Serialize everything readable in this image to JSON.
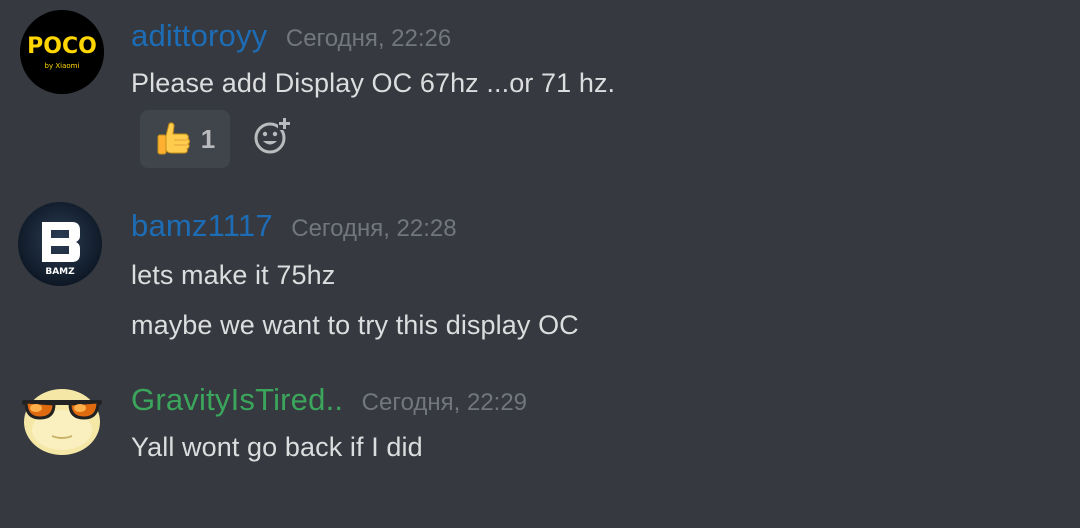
{
  "messages": [
    {
      "username": "adittoroyy",
      "username_color": "#1d6db6",
      "timestamp": "Сегодня, 22:26",
      "avatar": {
        "icon": "poco-logo-icon",
        "brand": "POCO",
        "sub": "by Xiaomi"
      },
      "lines": [
        "Please add Display OC 67hz ...or 71 hz."
      ],
      "reaction": {
        "emoji": "thumbs-up-icon",
        "count": "1"
      }
    },
    {
      "username": "bamz1117",
      "username_color": "#1d6db6",
      "timestamp": "Сегодня, 22:28",
      "avatar": {
        "icon": "bamz-logo-icon",
        "brand": "BAMZ"
      },
      "lines": [
        "lets make it 75hz",
        "maybe we want to try this display OC"
      ]
    },
    {
      "username": "GravityIsTired..",
      "username_color": "#3ba55c",
      "timestamp": "Сегодня, 22:29",
      "avatar": {
        "icon": "sunglasses-face-icon"
      },
      "lines": [
        "Yall wont go back if I did"
      ]
    }
  ],
  "add_reaction_icon": "add-reaction-icon"
}
